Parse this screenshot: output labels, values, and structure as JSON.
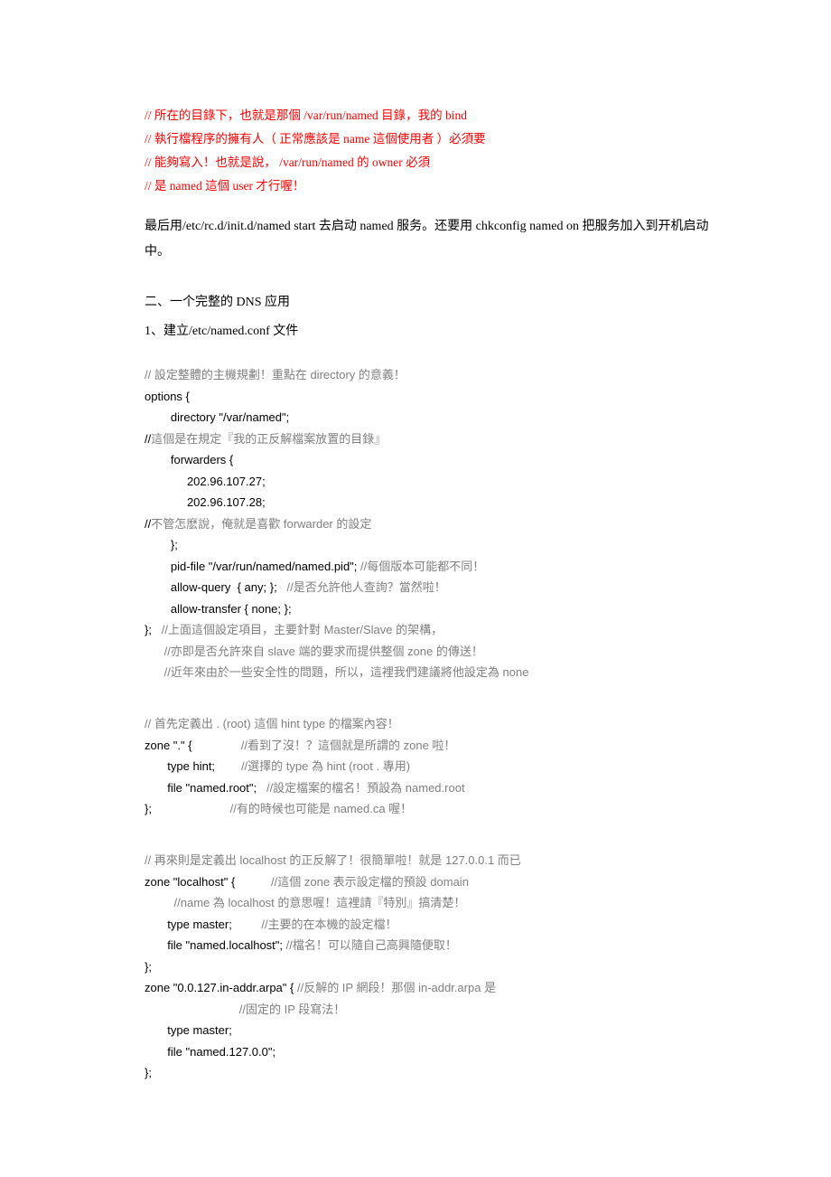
{
  "red_lines": [
    "// 所在的目錄下，也就是那個 /var/run/named 目錄，我的 bind",
    "// 執行檔程序的擁有人（ 正常應該是 name 這個使用者 ）必須要",
    "// 能夠寫入！也就是說， /var/run/named 的 owner 必須",
    "// 是 named 這個 user 才行喔！"
  ],
  "body_zh": "最后用/etc/rc.d/init.d/named start 去启动 named 服务。还要用 chkconfig named on 把服务加入到开机启动中。",
  "section_h": "二、一个完整的 DNS 应用",
  "section_h2": "1、建立/etc/named.conf 文件",
  "code": {
    "l01": "// 設定整體的主機規劃！重點在 directory 的意義！",
    "l02": "options {",
    "l03": "        directory \"/var/named\";",
    "l04a": "//",
    "l04b": "這個是在規定『我的正反解檔案放置的目錄』",
    "l05": "        forwarders {",
    "l06": "             202.96.107.27;",
    "l07": "             202.96.107.28;",
    "l08a": "//",
    "l08b": "不管怎麽說，俺就是喜歡 forwarder 的設定",
    "l09": "        };",
    "l10a": "        pid-file \"/var/run/named/named.pid\"; ",
    "l10b": "//每個版本可能都不同！",
    "l11a": "        allow-query  { any; };   ",
    "l11b": "//是否允許他人查詢？當然啦！",
    "l12": "        allow-transfer { none; };",
    "l13a": "};   ",
    "l13b": "//上面這個設定項目，主要針對 Master/Slave 的架構，",
    "l14": "      //亦即是否允許來自 slave 端的要求而提供整個 zone 的傳送！",
    "l15": "      //近年來由於一些安全性的問題，所以，這裡我們建議將他設定為 none",
    "l17": "// 首先定義出 . (root) 這個 hint type 的檔案內容！",
    "l18a": "zone \".\" {               ",
    "l18b": "//看到了沒！？這個就是所謂的 zone 啦！",
    "l19a": "       type hint;        ",
    "l19b": "//選擇的 type 為 hint (root . 專用)",
    "l20a": "       file \"named.root\";   ",
    "l20b": "//設定檔案的檔名！預設為 named.root",
    "l21a": "};                        ",
    "l21b": "//有的時候也可能是 named.ca 喔！",
    "l23": "// 再來則是定義出 localhost 的正反解了！很簡單啦！就是 127.0.0.1 而已",
    "l24a": "zone \"localhost\" {           ",
    "l24b": "//這個 zone 表示設定檔的預設 domain",
    "l25": "         //name 為 localhost 的意思喔！這裡請『特別』搞清楚！",
    "l26a": "       type master;         ",
    "l26b": "//主要的在本機的設定檔！",
    "l27a": "       file \"named.localhost\"; ",
    "l27b": "//檔名！可以隨自己高興隨便取！",
    "l28": "};",
    "l29a": "zone \"0.0.127.in-addr.arpa\" { ",
    "l29b": "//反解的 IP 網段！那個 in-addr.arpa 是",
    "l30": "                             //固定的 IP 段寫法！",
    "l31": "       type master;",
    "l32": "       file \"named.127.0.0\";",
    "l33": "};"
  }
}
